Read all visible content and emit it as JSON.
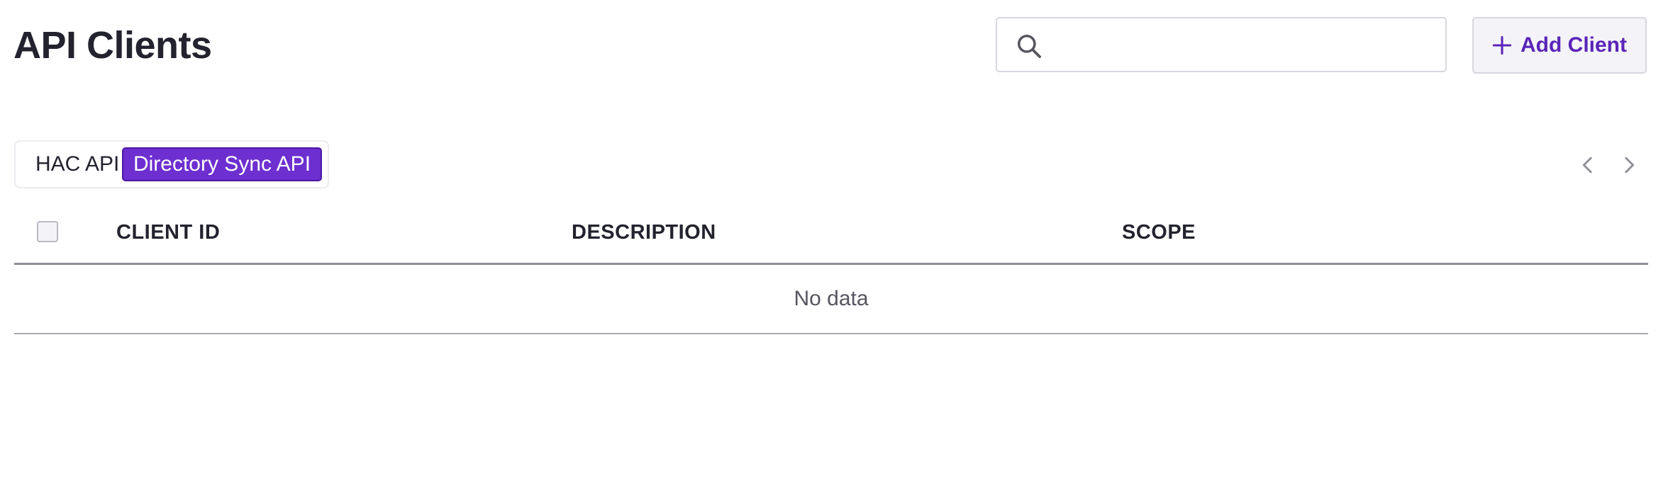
{
  "page": {
    "title": "API Clients"
  },
  "search": {
    "placeholder": "",
    "value": "",
    "icon": "search-icon"
  },
  "toolbar": {
    "add_client_label": "Add Client",
    "add_client_icon": "plus-icon"
  },
  "tabs": [
    {
      "label": "HAC API",
      "active": false
    },
    {
      "label": "Directory Sync API",
      "active": true
    }
  ],
  "pagination": {
    "prev_icon": "chevron-left-icon",
    "next_icon": "chevron-right-icon"
  },
  "table": {
    "columns": [
      "CLIENT ID",
      "DESCRIPTION",
      "SCOPE"
    ],
    "rows": [],
    "empty_message": "No data"
  },
  "colors": {
    "accent": "#6d2fd0",
    "accent_text": "#5b24b8",
    "text": "#23232f",
    "border": "#d7d7de"
  }
}
